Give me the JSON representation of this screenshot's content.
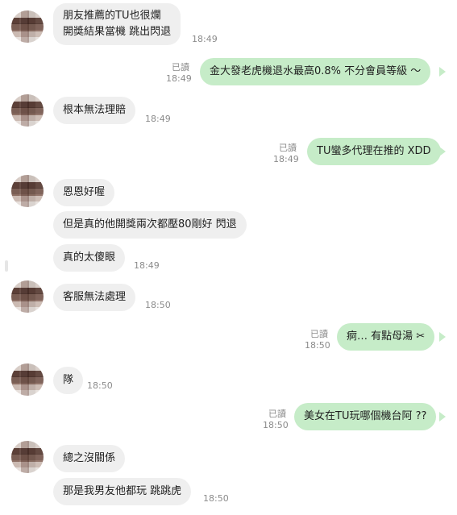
{
  "messages": [
    {
      "side": "in",
      "text_lines": [
        "朋友推薦的TU也很爛",
        "開獎結果當機 跳出閃退"
      ],
      "time": "18:49"
    },
    {
      "side": "out",
      "text": "金大發老虎機退水最高0.8% 不分會員等級 ～",
      "read": "已讀",
      "time": "18:49"
    },
    {
      "side": "in",
      "text": "根本無法理賠",
      "time": "18:49"
    },
    {
      "side": "out",
      "text": "TU蠻多代理在推的 XDD",
      "read": "已讀",
      "time": "18:49"
    },
    {
      "side": "in",
      "text": "恩恩好喔"
    },
    {
      "side": "in",
      "text": "但是真的他開獎兩次都壓80剛好 閃退"
    },
    {
      "side": "in",
      "text": "真的太傻眼",
      "time": "18:49"
    },
    {
      "side": "in",
      "text": "客服無法處理",
      "time": "18:50"
    },
    {
      "side": "out",
      "text": "痾… 有點母湯 ✂",
      "read": "已讀",
      "time": "18:50"
    },
    {
      "side": "in",
      "text": "隊",
      "time": "18:50"
    },
    {
      "side": "out",
      "text": "美女在TU玩哪個機台阿 ??",
      "read": "已讀",
      "time": "18:50"
    },
    {
      "side": "in",
      "text": "總之沒關係"
    },
    {
      "side": "in",
      "text": "那是我男友他都玩 跳跳虎",
      "time": "18:50"
    }
  ]
}
